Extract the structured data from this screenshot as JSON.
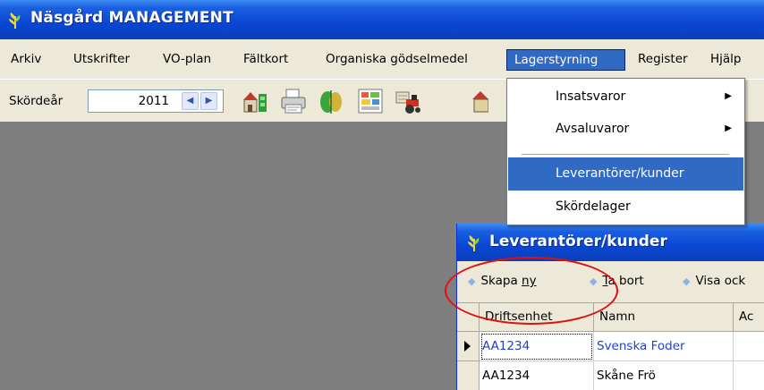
{
  "window": {
    "title": "Näsgård MANAGEMENT"
  },
  "menubar": {
    "items": [
      "Arkiv",
      "Utskrifter",
      "VO-plan",
      "Fältkort",
      "Organiska gödselmedel",
      "Lagerstyrning",
      "Register",
      "Hjälp"
    ],
    "active": "Lagerstyrning"
  },
  "toolbar": {
    "year_label": "Skördeår",
    "year_value": "2011",
    "icons": [
      "farm-icon",
      "printer-icon",
      "crop-icon",
      "field-map-icon",
      "tractor-icon",
      "barn-icon"
    ]
  },
  "dropdown": {
    "items": [
      {
        "label": "Insatsvaror",
        "submenu": true
      },
      {
        "label": "Avsaluvaror",
        "submenu": true
      },
      {
        "label": "Leverantörer/kunder",
        "submenu": false,
        "selected": true
      },
      {
        "label": "Skördelager",
        "submenu": false
      }
    ]
  },
  "child_window": {
    "title": "Leverantörer/kunder",
    "toolbar": {
      "create_prefix": "Skapa ",
      "create_accel": "ny",
      "delete_accel": "T",
      "delete_rest": "a bort",
      "show_label": "Visa ock"
    },
    "grid": {
      "columns": [
        "Driftsenhet",
        "Namn",
        "Ac"
      ],
      "rows": [
        {
          "driftsenhet": "AA1234",
          "namn": "Svenska Foder",
          "selected": true
        },
        {
          "driftsenhet": "AA1234",
          "namn": "Skåne Frö",
          "selected": false
        }
      ]
    }
  },
  "colors": {
    "titlebar": "#0a46d4",
    "menu_highlight": "#316ac5",
    "workspace": "#7f7f7f",
    "link_text": "#1f3fd0",
    "annotation": "#e01010"
  }
}
